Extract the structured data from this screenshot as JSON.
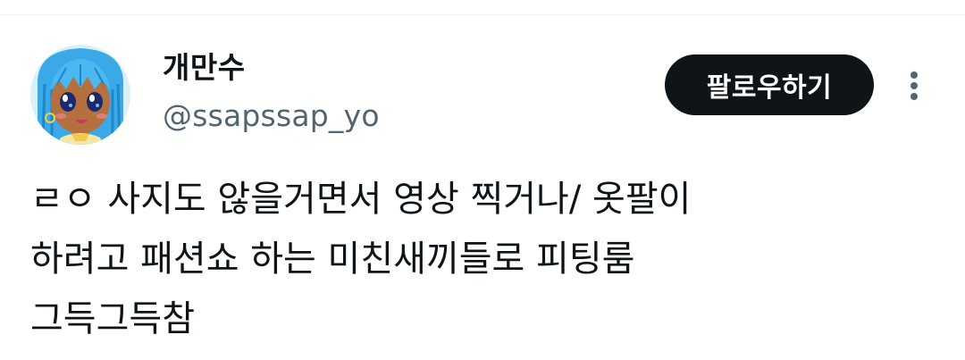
{
  "profile": {
    "display_name": "개만수",
    "handle": "@ssapssap_yo",
    "avatar_icon": "anime-character-avatar"
  },
  "actions": {
    "follow_label": "팔로우하기",
    "more_icon": "more-vertical-icon"
  },
  "tweet": {
    "lines": [
      "ㄹㅇ 사지도 않을거면서 영상 찍거나/ 옷팔이",
      "하려고 패션쇼 하는 미친새끼들로 피팅룸",
      "그득그득참"
    ]
  },
  "colors": {
    "follow_button_bg": "#0f1419",
    "handle_text": "#536471",
    "avatar_hair": "#3aa9e8",
    "avatar_skin": "#b5703f"
  }
}
